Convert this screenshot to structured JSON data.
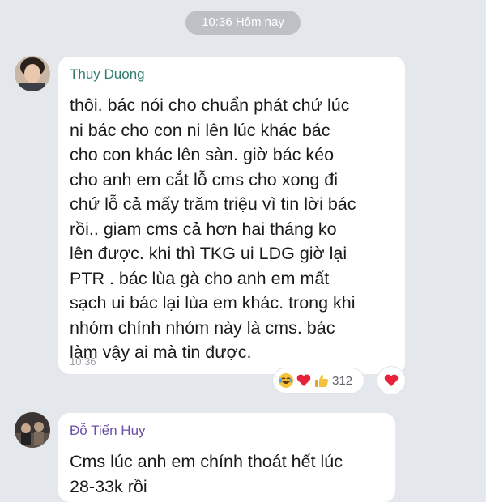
{
  "date_separator": "10:36 Hôm nay",
  "messages": [
    {
      "sender": "Thuy Duong",
      "text": "thôi. bác nói cho chuẩn phát chứ lúc\nni bác cho con ni lên lúc khác bác\ncho con khác lên sàn. giờ bác kéo\ncho anh em cắt lỗ cms cho xong đi\nchứ lỗ cả mấy trăm triệu vì tin lời bác\nrồi.. giam cms cả hơn hai tháng ko\nlên được. khi thì TKG ui LDG giờ lại\nPTR . bác lùa gà cho anh em mất\nsạch ui bác lại lùa em khác. trong khi\nnhóm chính nhóm này là cms. bác\nlàm vậy ai mà tin được.",
      "time": "10:36",
      "reactions": {
        "emojis": [
          "laughing-crying-icon",
          "heart-icon",
          "thumbs-up-icon"
        ],
        "count": "312"
      }
    },
    {
      "sender": "Đỗ Tiến Huy",
      "text": "Cms lúc anh em chính thoát hết lúc\n28-33k rồi"
    }
  ],
  "colors": {
    "background": "#e4e8ed",
    "sender_1": "#2d7d6a",
    "sender_2": "#6a4fa8",
    "heart": "#e8223b"
  }
}
